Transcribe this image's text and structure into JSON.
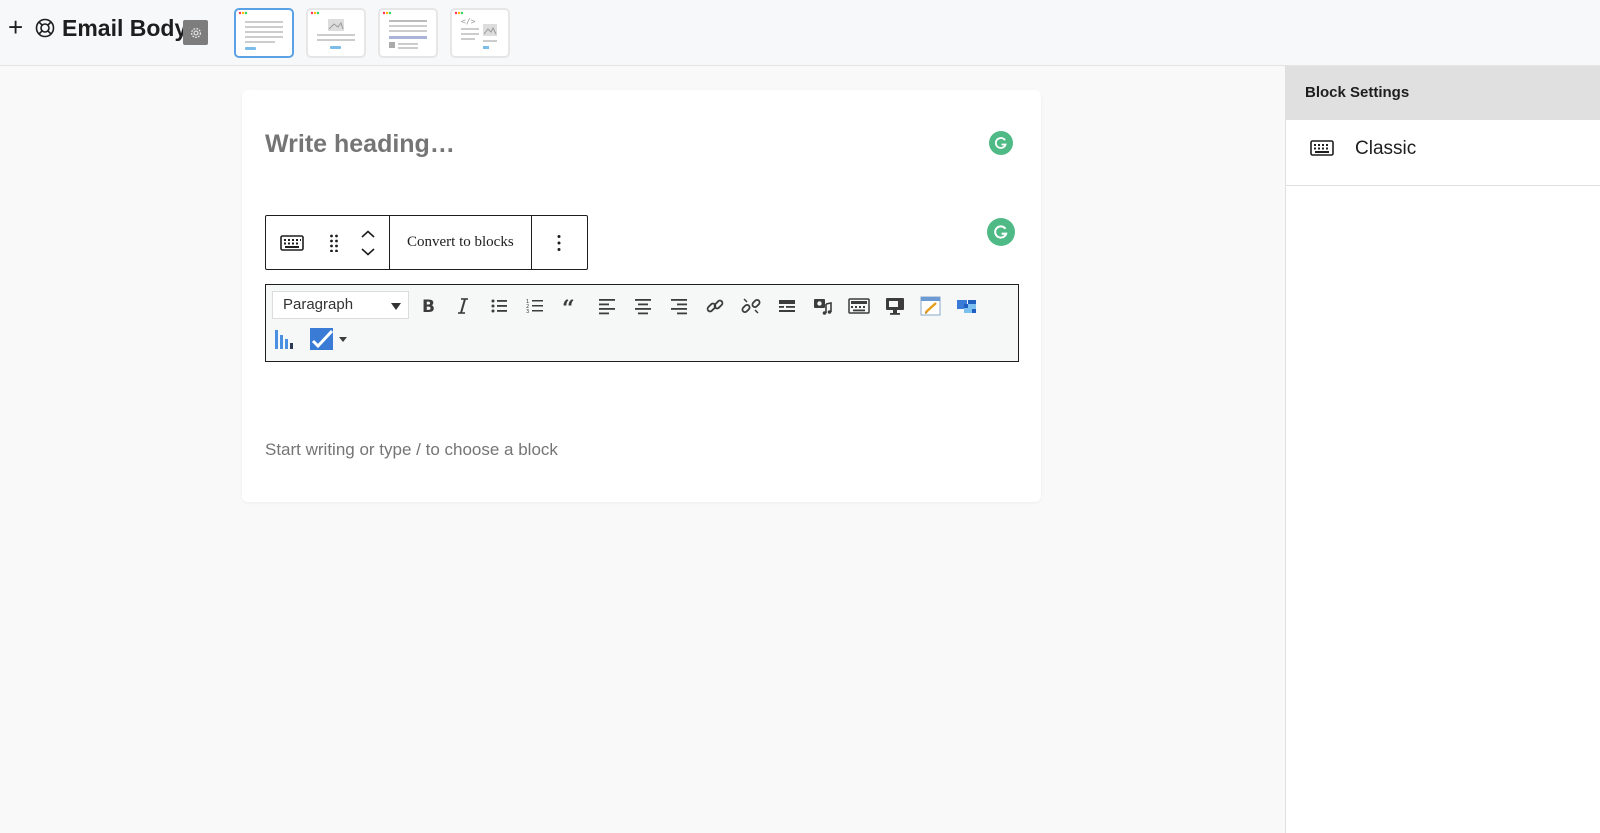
{
  "header": {
    "title": "Email Body",
    "templates": [
      {
        "name": "template-text",
        "active": true
      },
      {
        "name": "template-image",
        "active": false
      },
      {
        "name": "template-article",
        "active": false
      },
      {
        "name": "template-code",
        "active": false
      }
    ]
  },
  "editor": {
    "heading_placeholder": "Write heading…",
    "block_toolbar": {
      "convert_label": "Convert to blocks"
    },
    "mce_toolbar": {
      "format_select": "Paragraph",
      "buttons": [
        "bold",
        "italic",
        "bulleted-list",
        "numbered-list",
        "blockquote",
        "align-left",
        "align-center",
        "align-right",
        "insert-link",
        "remove-link",
        "read-more",
        "add-media",
        "toolbar-toggle",
        "fullscreen",
        "edit-note",
        "table",
        "chart",
        "checkbox"
      ]
    },
    "block_placeholder": "Start writing or type / to choose a block"
  },
  "sidebar": {
    "header": "Block Settings",
    "block_name": "Classic"
  },
  "colors": {
    "accent": "#5aa1e6",
    "grammarly": "#4fba86",
    "sidebar_header": "#e0e0e0"
  }
}
